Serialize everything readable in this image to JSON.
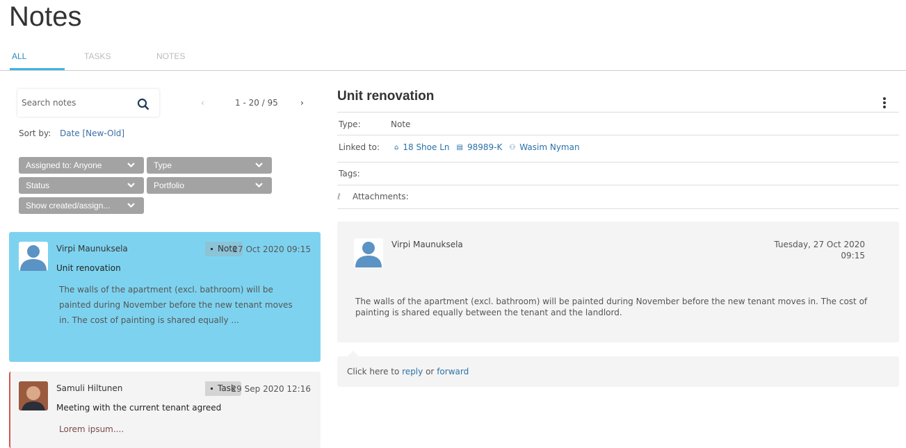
{
  "page_title": "Notes",
  "tabs": [
    {
      "label": "ALL",
      "active": true
    },
    {
      "label": "TASKS"
    },
    {
      "label": "NOTES"
    }
  ],
  "search": {
    "placeholder": "Search notes"
  },
  "pager": {
    "range": "1 - 20 / 95"
  },
  "sort": {
    "label": "Sort by:",
    "value": "Date [New-Old]"
  },
  "filters": [
    "Assigned to: Anyone",
    "Type",
    "Status",
    "Portfolio",
    "Show created/assign..."
  ],
  "notes": [
    {
      "author": "Virpi Maunuksela",
      "type": "Note",
      "date": "27 Oct 2020 09:15",
      "title": "Unit renovation",
      "excerpt": "The walls of the apartment (excl. bathroom) will be painted during November before the new tenant moves in. The cost of painting is shared equally ..."
    },
    {
      "author": "Samuli Hiltunen",
      "type": "Task",
      "date": "29 Sep 2020 12:16",
      "title": "Meeting with the current tenant agreed",
      "excerpt": "Lorem ipsum...."
    }
  ],
  "detail": {
    "title": "Unit renovation",
    "type_label": "Type:",
    "type_value": "Note",
    "linked_label": "Linked to:",
    "links": [
      "18 Shoe Ln",
      "98989-K",
      "Wasim Nyman"
    ],
    "tags_label": "Tags:",
    "attachments_label": "Attachments:",
    "message": {
      "author": "Virpi Maunuksela",
      "date": "Tuesday, 27 Oct 2020",
      "time": "09:15",
      "body": "The walls of the apartment (excl. bathroom) will be painted during November before the new tenant moves in. The cost of painting is shared equally between the tenant and the landlord."
    },
    "reply": {
      "prefix": "Click here to",
      "reply": "reply",
      "or": "or",
      "forward": "forward"
    }
  },
  "colors": {
    "selected": "#7dd3ef",
    "accent": "#3fb4e5",
    "link": "#2a72a8",
    "task_border": "#d9534f"
  }
}
